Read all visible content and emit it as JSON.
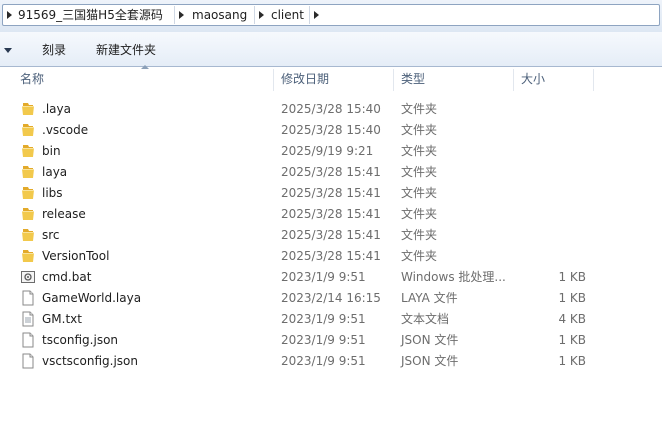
{
  "breadcrumb": {
    "items": [
      "91569_三国猫H5全套源码",
      "maosang",
      "client"
    ]
  },
  "toolbar": {
    "burn_label": "刻录",
    "new_folder_label": "新建文件夹"
  },
  "columns": {
    "name": "名称",
    "date": "修改日期",
    "type": "类型",
    "size": "大小"
  },
  "files": [
    {
      "name": ".laya",
      "date": "2025/3/28 15:40",
      "type": "文件夹",
      "size": "",
      "icon": "folder-icon"
    },
    {
      "name": ".vscode",
      "date": "2025/3/28 15:40",
      "type": "文件夹",
      "size": "",
      "icon": "folder-icon"
    },
    {
      "name": "bin",
      "date": "2025/9/19 9:21",
      "type": "文件夹",
      "size": "",
      "icon": "folder-icon"
    },
    {
      "name": "laya",
      "date": "2025/3/28 15:41",
      "type": "文件夹",
      "size": "",
      "icon": "folder-icon"
    },
    {
      "name": "libs",
      "date": "2025/3/28 15:41",
      "type": "文件夹",
      "size": "",
      "icon": "folder-icon"
    },
    {
      "name": "release",
      "date": "2025/3/28 15:41",
      "type": "文件夹",
      "size": "",
      "icon": "folder-icon"
    },
    {
      "name": "src",
      "date": "2025/3/28 15:41",
      "type": "文件夹",
      "size": "",
      "icon": "folder-icon"
    },
    {
      "name": "VersionTool",
      "date": "2025/3/28 15:41",
      "type": "文件夹",
      "size": "",
      "icon": "folder-icon"
    },
    {
      "name": "cmd.bat",
      "date": "2023/1/9 9:51",
      "type": "Windows 批处理...",
      "size": "1 KB",
      "icon": "batch-file-icon"
    },
    {
      "name": "GameWorld.laya",
      "date": "2023/2/14 16:15",
      "type": "LAYA 文件",
      "size": "1 KB",
      "icon": "file-icon"
    },
    {
      "name": "GM.txt",
      "date": "2023/1/9 9:51",
      "type": "文本文档",
      "size": "4 KB",
      "icon": "text-file-icon"
    },
    {
      "name": "tsconfig.json",
      "date": "2023/1/9 9:51",
      "type": "JSON 文件",
      "size": "1 KB",
      "icon": "file-icon"
    },
    {
      "name": "vsctsconfig.json",
      "date": "2023/1/9 9:51",
      "type": "JSON 文件",
      "size": "1 KB",
      "icon": "file-icon"
    }
  ],
  "colors": {
    "folder": "#f2c94c",
    "header_text": "#4c607a",
    "secondary_text": "#6d6d6d"
  }
}
